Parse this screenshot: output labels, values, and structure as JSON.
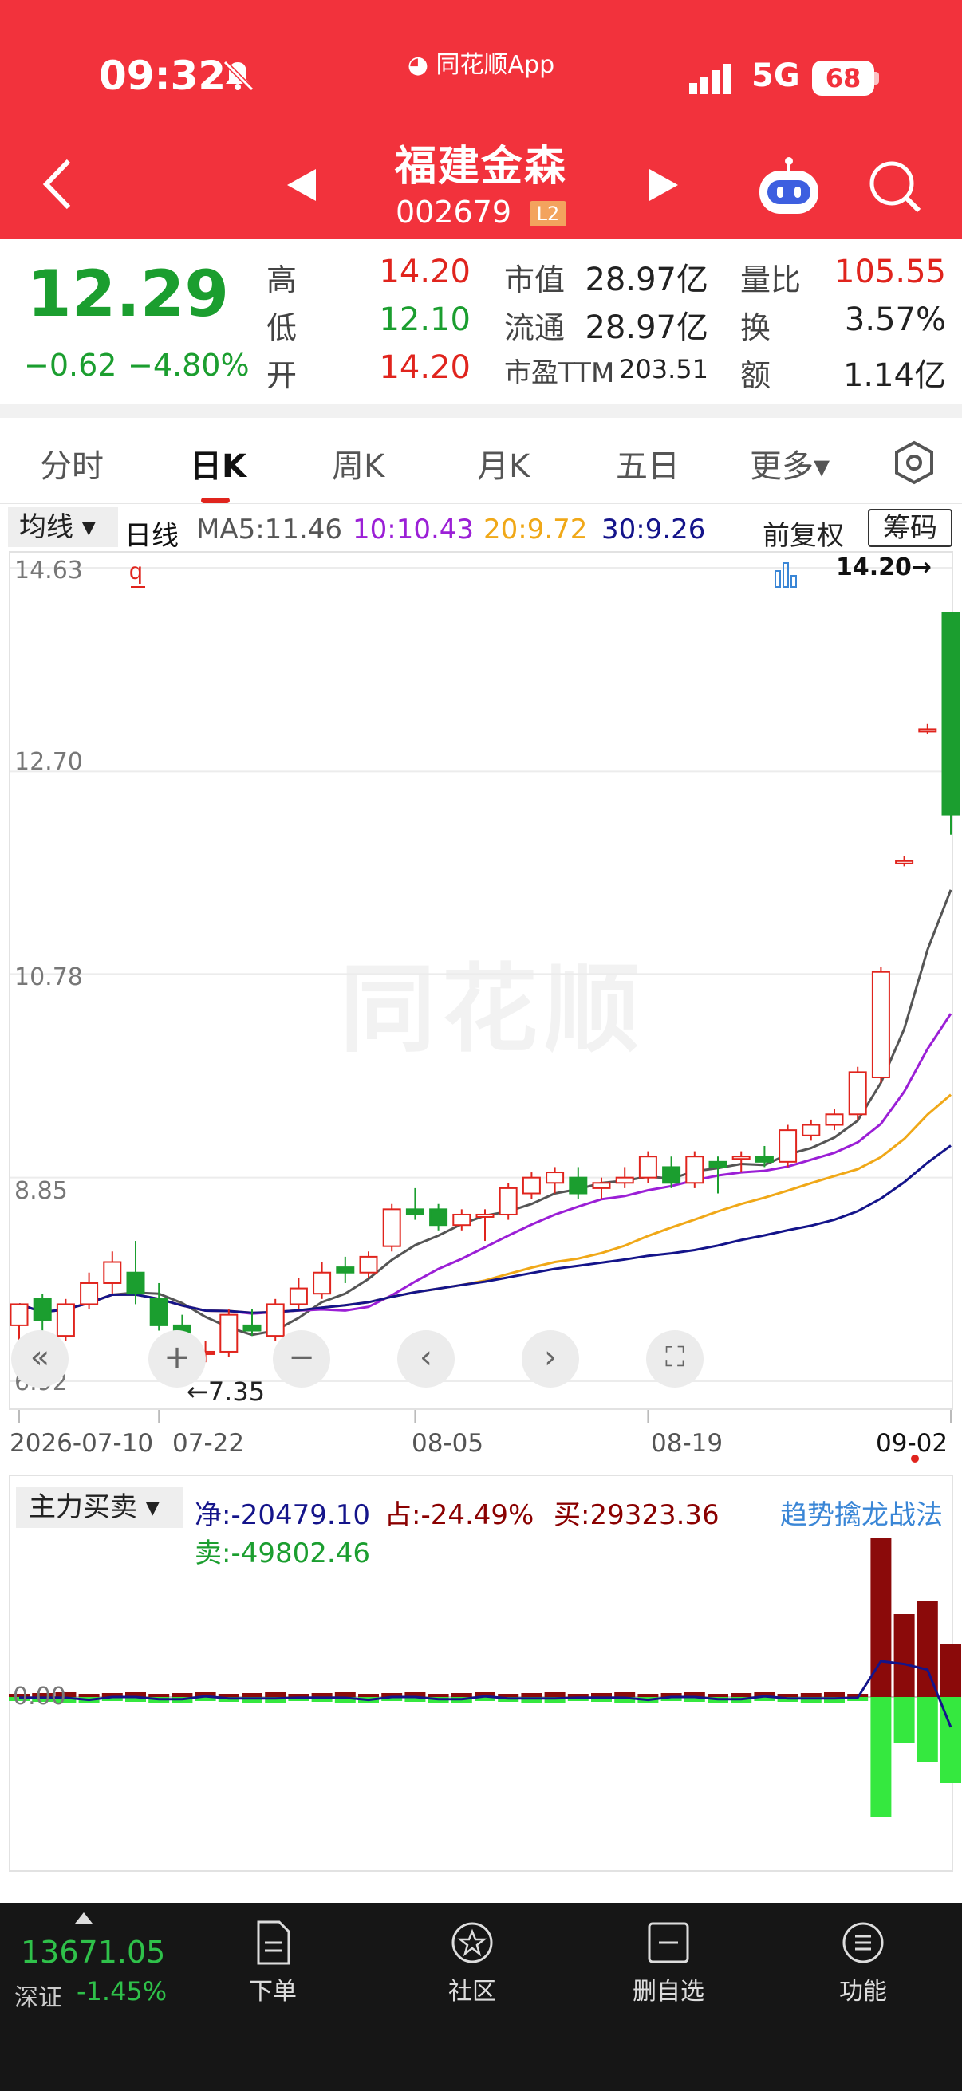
{
  "status_bar": {
    "time": "09:32",
    "app_label": "同花顺App",
    "network": "5G",
    "battery": "68"
  },
  "header": {
    "stock_name": "福建金森",
    "stock_code": "002679",
    "level_badge": "L2"
  },
  "quote": {
    "price": "12.29",
    "change": "−0.62",
    "change_pct": "−4.80%",
    "rows": [
      {
        "l1": "高",
        "v1": "14.20",
        "l2": "市值",
        "v2": "28.97亿",
        "l3": "量比",
        "v3": "105.55"
      },
      {
        "l1": "低",
        "v1": "12.10",
        "l2": "流通",
        "v2": "28.97亿",
        "l3": "换",
        "v3": "3.57%"
      },
      {
        "l1": "开",
        "v1": "14.20",
        "l2": "市盈TTM",
        "v2": "203.51",
        "l3": "额",
        "v3": "1.14亿"
      }
    ]
  },
  "tabs": [
    "分时",
    "日K",
    "周K",
    "月K",
    "五日",
    "更多▾"
  ],
  "ma_bar": {
    "dropdown": "均线 ▾",
    "period": "日线",
    "ma5": "MA5:11.46",
    "ma10": "10:10.43",
    "ma20": "20:9.72",
    "ma30": "30:9.26",
    "fuquan": "前复权",
    "chouma": "筹码"
  },
  "colors": {
    "up": "#e0241d",
    "down": "#1b9e2f",
    "ma5": "#555555",
    "ma10": "#9b1fd6",
    "ma20": "#f0a818",
    "ma30": "#14148a"
  },
  "chart_data": {
    "type": "candlestick",
    "y_ticks": [
      "14.63",
      "12.70",
      "10.78",
      "8.85",
      "6.92"
    ],
    "x_ticks": [
      "2026-07-10",
      "07-22",
      "08-05",
      "08-19",
      "09-02"
    ],
    "high_label": "14.20→",
    "low_label": "←7.35",
    "ylim": [
      6.92,
      14.63
    ],
    "candles": [
      [
        7.45,
        7.65,
        7.25,
        7.55
      ],
      [
        7.7,
        7.5,
        7.35,
        7.75
      ],
      [
        7.35,
        7.65,
        7.3,
        7.7
      ],
      [
        7.65,
        7.85,
        7.6,
        7.95
      ],
      [
        7.85,
        8.05,
        7.75,
        8.15
      ],
      [
        7.95,
        7.75,
        7.65,
        8.25
      ],
      [
        7.7,
        7.45,
        7.4,
        7.85
      ],
      [
        7.45,
        7.2,
        7.15,
        7.55
      ],
      [
        7.2,
        7.2,
        7.1,
        7.3
      ],
      [
        7.2,
        7.55,
        7.15,
        7.6
      ],
      [
        7.45,
        7.4,
        7.35,
        7.6
      ],
      [
        7.35,
        7.65,
        7.3,
        7.7
      ],
      [
        7.65,
        7.8,
        7.6,
        7.9
      ],
      [
        7.75,
        7.95,
        7.7,
        8.05
      ],
      [
        8.0,
        7.95,
        7.85,
        8.1
      ],
      [
        7.95,
        8.1,
        7.9,
        8.15
      ],
      [
        8.2,
        8.55,
        8.15,
        8.6
      ],
      [
        8.55,
        8.5,
        8.45,
        8.75
      ],
      [
        8.55,
        8.4,
        8.35,
        8.6
      ],
      [
        8.4,
        8.5,
        8.35,
        8.55
      ],
      [
        8.5,
        8.5,
        8.25,
        8.55
      ],
      [
        8.5,
        8.75,
        8.45,
        8.8
      ],
      [
        8.7,
        8.85,
        8.65,
        8.9
      ],
      [
        8.8,
        8.9,
        8.7,
        8.95
      ],
      [
        8.85,
        8.7,
        8.65,
        8.95
      ],
      [
        8.75,
        8.8,
        8.65,
        8.85
      ],
      [
        8.8,
        8.85,
        8.75,
        8.95
      ],
      [
        8.85,
        9.05,
        8.8,
        9.1
      ],
      [
        8.95,
        8.8,
        8.75,
        9.05
      ],
      [
        8.8,
        9.05,
        8.75,
        9.1
      ],
      [
        9.0,
        8.95,
        8.7,
        9.05
      ],
      [
        9.05,
        9.05,
        8.9,
        9.1
      ],
      [
        9.05,
        9.0,
        8.95,
        9.15
      ],
      [
        9.0,
        9.3,
        8.95,
        9.35
      ],
      [
        9.25,
        9.35,
        9.2,
        9.4
      ],
      [
        9.35,
        9.45,
        9.3,
        9.5
      ],
      [
        9.45,
        9.85,
        9.4,
        9.9
      ],
      [
        9.8,
        10.8,
        9.75,
        10.85
      ],
      [
        11.85,
        11.85,
        11.8,
        11.9
      ],
      [
        13.1,
        13.1,
        13.05,
        13.15
      ],
      [
        14.2,
        12.29,
        12.1,
        14.2
      ]
    ]
  },
  "flow_panel": {
    "dropdown": "主力买卖 ▾",
    "net": "净:-20479.10",
    "ratio": "占:-24.49%",
    "buy": "买:29323.36",
    "sell": "卖:-49802.46",
    "trend_link": "趋势擒龙战法",
    "zero_label": "0.00"
  },
  "bottom_nav": {
    "index_value": "13671.05",
    "index_name": "深证",
    "index_change": "-1.45%",
    "items": [
      "下单",
      "社区",
      "删自选",
      "功能"
    ]
  },
  "watermark": "同花顺"
}
